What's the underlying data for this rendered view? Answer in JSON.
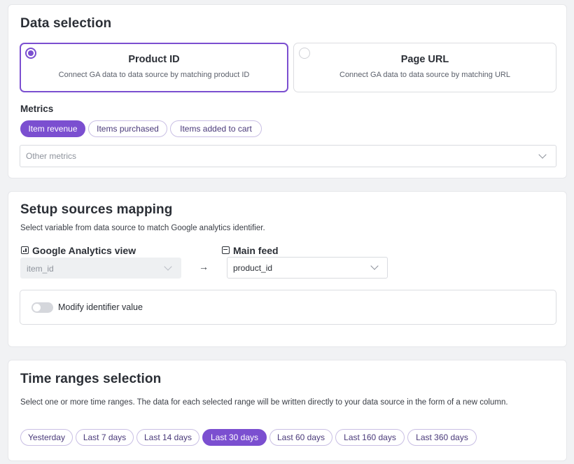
{
  "data_selection": {
    "title": "Data selection",
    "options": [
      {
        "title": "Product ID",
        "description": "Connect GA data to data source by matching product ID",
        "selected": true
      },
      {
        "title": "Page URL",
        "description": "Connect GA data to data source by matching URL",
        "selected": false
      }
    ],
    "metrics_label": "Metrics",
    "metric_chips": [
      "Item revenue",
      "Items purchased",
      "Items added to cart"
    ],
    "active_metric": "Item revenue",
    "other_metrics_placeholder": "Other metrics"
  },
  "mapping": {
    "title": "Setup sources mapping",
    "description": "Select variable from data source to match Google analytics identifier.",
    "ga_label": "Google Analytics view",
    "ga_value": "item_id",
    "arrow": "→",
    "feed_label": "Main feed",
    "feed_value": "product_id",
    "toggle_label": "Modify identifier value",
    "toggle_on": false
  },
  "time_ranges": {
    "title": "Time ranges selection",
    "description": "Select one or more time ranges. The data for each selected range will be written directly to your data source in the form of a new column.",
    "chips": [
      "Yesterday",
      "Last 7 days",
      "Last 14 days",
      "Last 30 days",
      "Last 60 days",
      "Last 160 days",
      "Last 360 days"
    ],
    "active": "Last 30 days"
  },
  "colors": {
    "accent": "#7b4fd0",
    "chip_border": "#c9bfe4",
    "background": "#f1f2f4"
  }
}
